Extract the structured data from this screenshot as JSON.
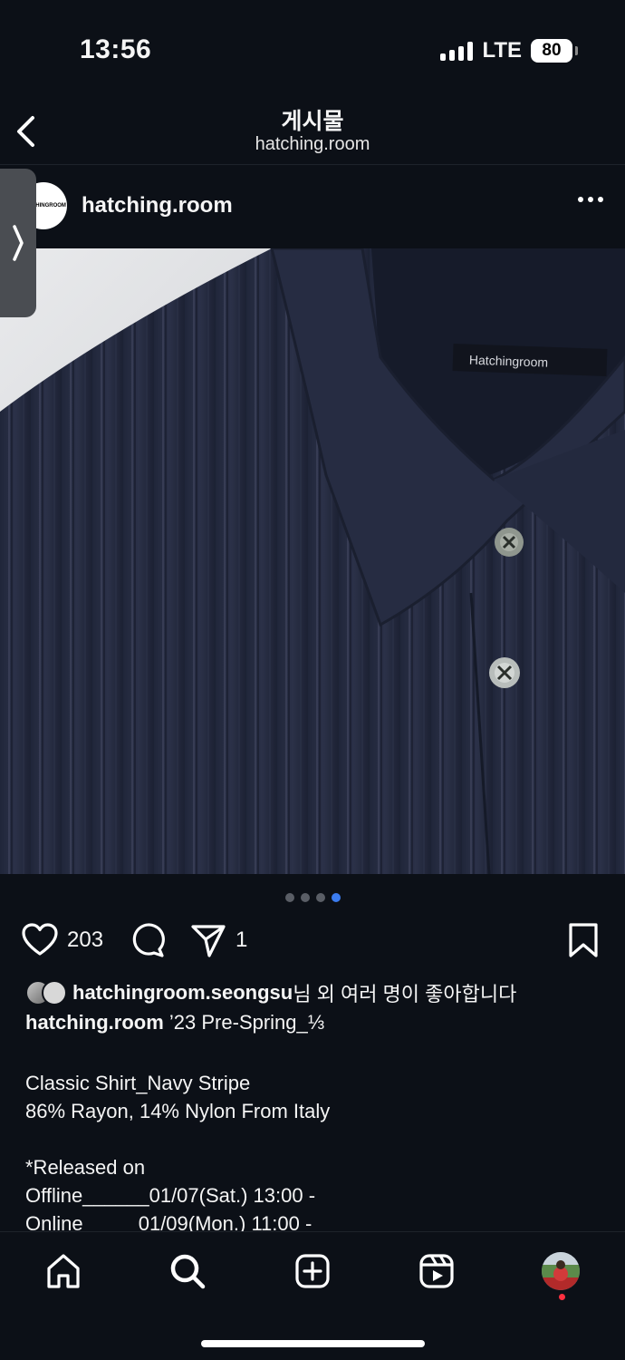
{
  "status_bar": {
    "time": "13:56",
    "network": "LTE",
    "battery": "80"
  },
  "header": {
    "title": "게시물",
    "subtitle": "hatching.room"
  },
  "post": {
    "username": "hatching.room",
    "avatar_text": "HATCHINGROOM",
    "label_text": "Hatchingroom",
    "carousel": {
      "total": 4,
      "active_index": 4
    },
    "like_count": "203",
    "share_count": "1",
    "liked_by_user": "hatchingroom.seongsu",
    "liked_by_suffix": "님 외 여러 명이 좋아합니다",
    "caption_user": "hatching.room",
    "caption_first": "’23 Pre-Spring_⅓",
    "caption_body": "Classic Shirt_Navy Stripe\n86% Rayon, 14% Nylon From Italy\n\n*Released on\nOffline______01/07(Sat.) 13:00 -\nOnline          01/09(Mon.) 11:00 -"
  },
  "icons": {
    "back": "chevron-left-icon",
    "more": "more-horizontal-icon",
    "like": "heart-icon",
    "comment": "comment-icon",
    "share": "send-icon",
    "save": "bookmark-icon",
    "home": "home-icon",
    "search": "search-icon",
    "create": "plus-square-icon",
    "reels": "reels-icon"
  },
  "colors": {
    "background": "#0c1017",
    "pager_active": "#3b7cf0",
    "notification": "#ff3040"
  }
}
